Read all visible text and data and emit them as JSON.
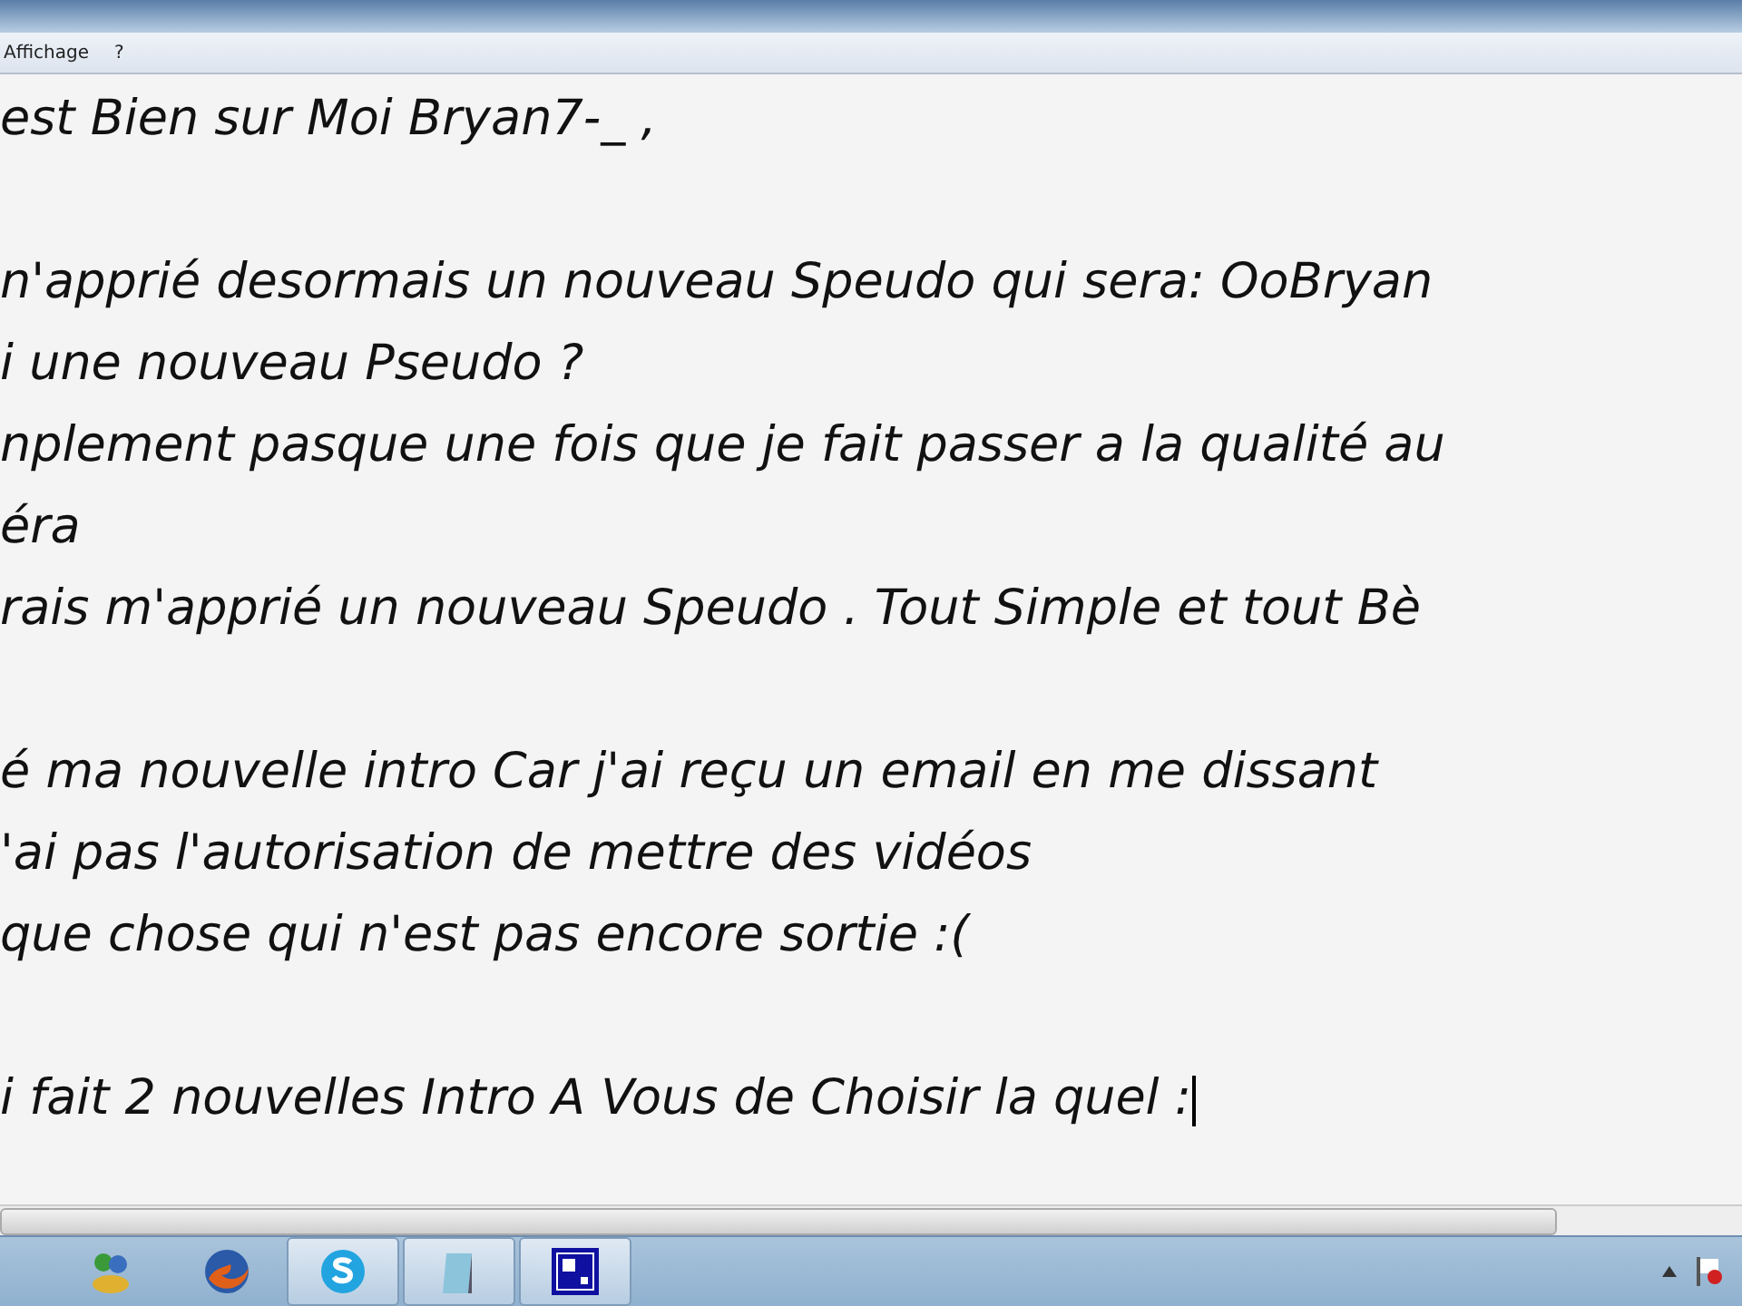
{
  "menu_bar": {
    "items": [
      "Affichage",
      "?"
    ]
  },
  "editor": {
    "paragraphs": [
      {
        "lines": [
          "est Bien sur Moi Bryan7-_ ,"
        ]
      },
      {
        "lines": [
          "n'apprié desormais un nouveau Speudo qui sera: OoBryan",
          "i une nouveau Pseudo ?",
          "nplement pasque une fois que je fait passer a la qualité au",
          "éra",
          "rais m'apprié un nouveau Speudo . Tout Simple et tout Bè"
        ]
      },
      {
        "lines": [
          "é ma nouvelle intro Car j'ai reçu un email en me dissant",
          "'ai pas l'autorisation de mettre des vidéos",
          "que chose qui n'est pas encore sortie :("
        ]
      },
      {
        "lines": [
          "i fait 2 nouvelles Intro A Vous de Choisir la quel :"
        ]
      }
    ]
  },
  "taskbar": {
    "apps": [
      {
        "kind": "messenger",
        "selected": false
      },
      {
        "kind": "browser",
        "selected": false
      },
      {
        "kind": "chat",
        "selected": true
      },
      {
        "kind": "notepad",
        "selected": true
      },
      {
        "kind": "window",
        "selected": true
      }
    ]
  }
}
